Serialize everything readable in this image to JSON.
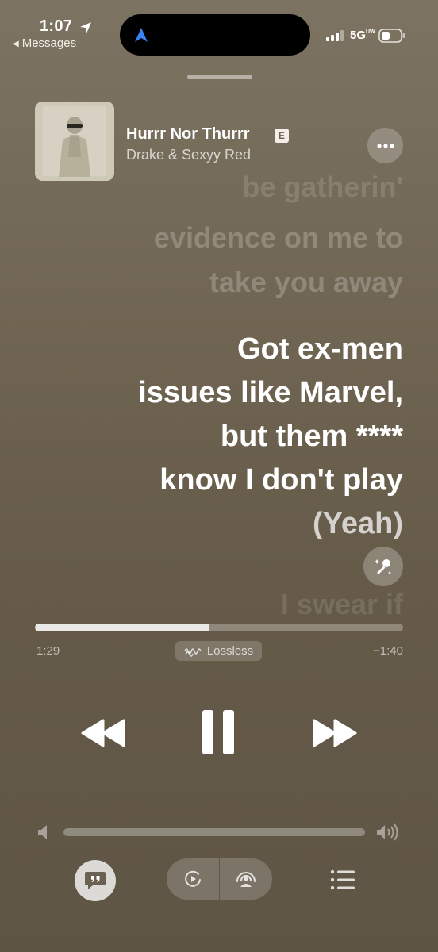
{
  "status_bar": {
    "time": "1:07",
    "back_app": "Messages",
    "network": "5G",
    "network_suffix": "UW"
  },
  "now_playing": {
    "title": "Hurrr Nor Thurrr",
    "explicit_badge": "E",
    "artist": "Drake & Sexyy Red"
  },
  "lyrics": {
    "faint_top": "be gatherin'",
    "previous": [
      "evidence on me to",
      "take you away"
    ],
    "current": [
      "Got ex-men",
      "issues like Marvel,",
      "but them ****",
      "know I don't play"
    ],
    "current_background": "(Yeah)",
    "next": "I swear if"
  },
  "playback": {
    "elapsed": "1:29",
    "remaining": "−1:40",
    "progress_fraction": 0.475,
    "quality_label": "Lossless"
  },
  "icons": {
    "more": "ellipsis-icon",
    "sing": "microphone-sparkle-icon",
    "rewind": "rewind-icon",
    "pause": "pause-icon",
    "forward": "fast-forward-icon",
    "lyrics": "lyrics-quote-icon",
    "autoplay": "autoplay-icon",
    "airplay": "airplay-icon",
    "queue": "queue-list-icon"
  }
}
